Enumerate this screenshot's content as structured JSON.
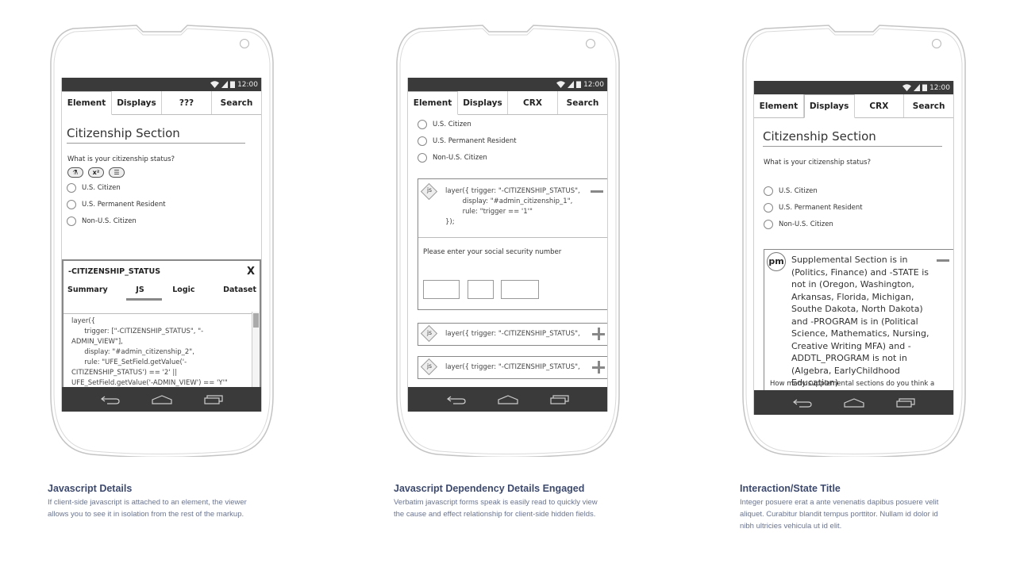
{
  "status_bar": {
    "time": "12:00",
    "icons": [
      "wifi-icon",
      "signal-icon",
      "battery-icon"
    ]
  },
  "phones": [
    {
      "tabs": [
        {
          "label": "Element",
          "active": true
        },
        {
          "label": "Displays",
          "active": false
        },
        {
          "label": "???",
          "active": false
        },
        {
          "label": "Search",
          "active": false
        }
      ],
      "section_title": "Citizenship Section",
      "question": "What is your citizenship status?",
      "toolbar": [
        {
          "icon": "flask-icon",
          "glyph": "⚗"
        },
        {
          "icon": "superscript-icon",
          "glyph": "x²"
        },
        {
          "icon": "list-icon",
          "glyph": "☰"
        }
      ],
      "options": [
        "U.S. Citizen",
        "U.S. Permanent Resident",
        "Non-U.S. Citizen"
      ],
      "panel": {
        "title": "-CITIZENSHIP_STATUS",
        "close_label": "X",
        "tabs": [
          {
            "label": "Summary",
            "active": false
          },
          {
            "label": "JS",
            "active": true
          },
          {
            "label": "Logic",
            "active": false
          },
          {
            "label": "Dataset",
            "active": false
          }
        ],
        "code": "layer({\n      trigger: [\"-CITIZENSHIP_STATUS\", \"-ADMIN_VIEW\"],\n      display: \"#admin_citizenship_2\",\n      rule: \"UFE_SetField.getValue('-CITIZENSHIP_STATUS') == '2' || UFE_SetField.getValue('-ADMIN_VIEW') == 'Y'\""
      }
    },
    {
      "tabs": [
        {
          "label": "Element",
          "active": true
        },
        {
          "label": "Displays",
          "active": false
        },
        {
          "label": "CRX",
          "active": false
        },
        {
          "label": "Search",
          "active": false
        }
      ],
      "options": [
        "U.S. Citizen",
        "U.S. Permanent Resident",
        "Non-U.S. Citizen"
      ],
      "expanded_js": {
        "badge": "js",
        "lines": [
          "layer({ trigger: \"-CITIZENSHIP_STATUS\",",
          "        display: \"#admin_citizenship_1\",",
          "        rule: \"trigger == '1'\"",
          "});"
        ],
        "field_label": "Please enter your social security number"
      },
      "collapsed_js": [
        {
          "badge": "js",
          "text": "layer({ trigger: \"-CITIZENSHIP_STATUS\","
        },
        {
          "badge": "js",
          "text": "layer({ trigger: \"-CITIZENSHIP_STATUS\","
        }
      ]
    },
    {
      "tabs": [
        {
          "label": "Element",
          "active": false
        },
        {
          "label": "Displays",
          "active": true
        },
        {
          "label": "CRX",
          "active": false
        },
        {
          "label": "Search",
          "active": false
        }
      ],
      "section_title": "Citizenship Section",
      "question": "What is your citizenship status?",
      "options": [
        "U.S. Citizen",
        "U.S. Permanent Resident",
        "Non-U.S. Citizen"
      ],
      "logic": {
        "badge": "pm",
        "text": "Supplemental Section is in (Politics, Finance) and -STATE is not in (Oregon, Washington, Arkansas, Florida, Michigan, Southe Dakota, North Dakota) and -PROGRAM is in (Political Science, Mathematics, Nursing, Creative Writing MFA) and -ADDTL_PROGRAM is not in (Algebra, EarlyChildhood Education)"
      },
      "next_question": "How many supplemental sections do you think a"
    }
  ],
  "captions": [
    {
      "title": "Javascript Details",
      "body": "If client-side javascript is attached to an element, the viewer allows you to see it in isolation from the rest of the markup."
    },
    {
      "title": "Javascript Dependency Details Engaged",
      "body": "Verbatim javascript forms speak is easily read to quickly view the cause and effect relationship for client-side hidden fields."
    },
    {
      "title": "Interaction/State Title",
      "body": "Integer posuere erat a ante venenatis dapibus posuere velit aliquet. Curabitur blandit tempus porttitor. Nullam id dolor id nibh ultricies vehicula ut id elit."
    }
  ]
}
